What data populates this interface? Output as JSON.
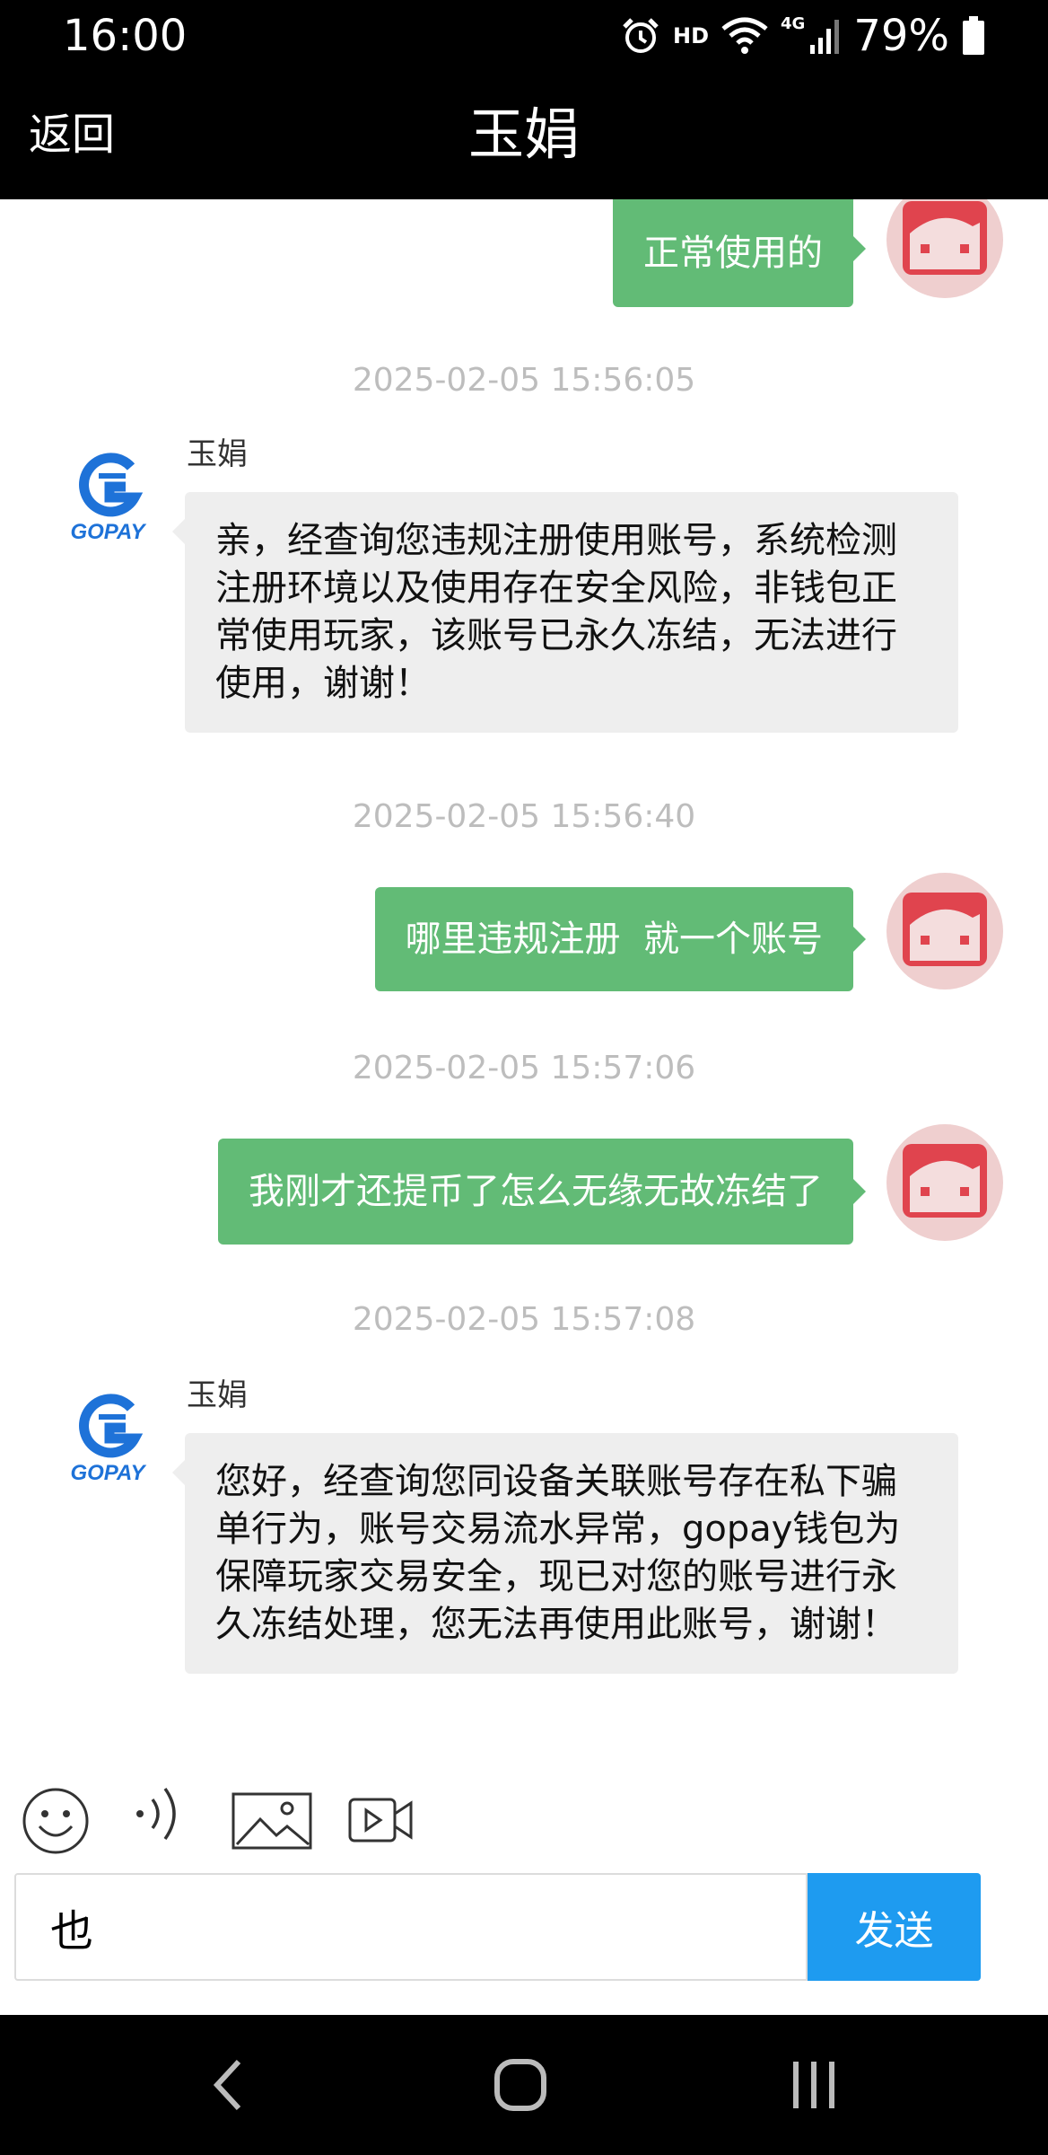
{
  "status_bar": {
    "time": "16:00",
    "hd": "HD",
    "network": "4G",
    "battery": "79%",
    "icons": [
      "alarm-icon",
      "wifi-icon",
      "signal-icon",
      "battery-icon"
    ]
  },
  "header": {
    "back_label": "返回",
    "title": "玉娟"
  },
  "chat": {
    "messages": [
      {
        "type": "outgoing",
        "text": "正常使用的"
      },
      {
        "type": "timestamp",
        "text": "2025-02-05 15:56:05"
      },
      {
        "type": "incoming",
        "sender": "玉娟",
        "text": "亲，经查询您违规注册使用账号，系统检测注册环境以及使用存在安全风险，非钱包正常使用玩家，该账号已永久冻结，无法进行使用，谢谢！"
      },
      {
        "type": "timestamp",
        "text": "2025-02-05 15:56:40"
      },
      {
        "type": "outgoing",
        "text": "哪里违规注册  就一个账号"
      },
      {
        "type": "timestamp",
        "text": "2025-02-05 15:57:06"
      },
      {
        "type": "outgoing",
        "text": "我刚才还提币了怎么无缘无故冻结了"
      },
      {
        "type": "timestamp",
        "text": "2025-02-05 15:57:08"
      },
      {
        "type": "incoming",
        "sender": "玉娟",
        "text": "您好，经查询您同设备关联账号存在私下骗单行为，账号交易流水异常，gopay钱包为保障玩家交易安全，现已对您的账号进行永久冻结处理，您无法再使用此账号，谢谢！"
      }
    ],
    "agent_logo_text": "GOPAY"
  },
  "toolbar": {
    "icons": [
      "emoji-icon",
      "voice-icon",
      "image-icon",
      "video-icon"
    ]
  },
  "composer": {
    "input_value": "也",
    "send_label": "发送"
  },
  "nav": {
    "icons": [
      "back-nav-icon",
      "home-nav-icon",
      "recents-nav-icon"
    ]
  },
  "colors": {
    "outgoing_bubble": "#62bb76",
    "incoming_bubble": "#eeeeee",
    "send_button": "#1e9bf0",
    "brand_blue": "#1e72d8",
    "avatar_red": "#e0444e"
  }
}
